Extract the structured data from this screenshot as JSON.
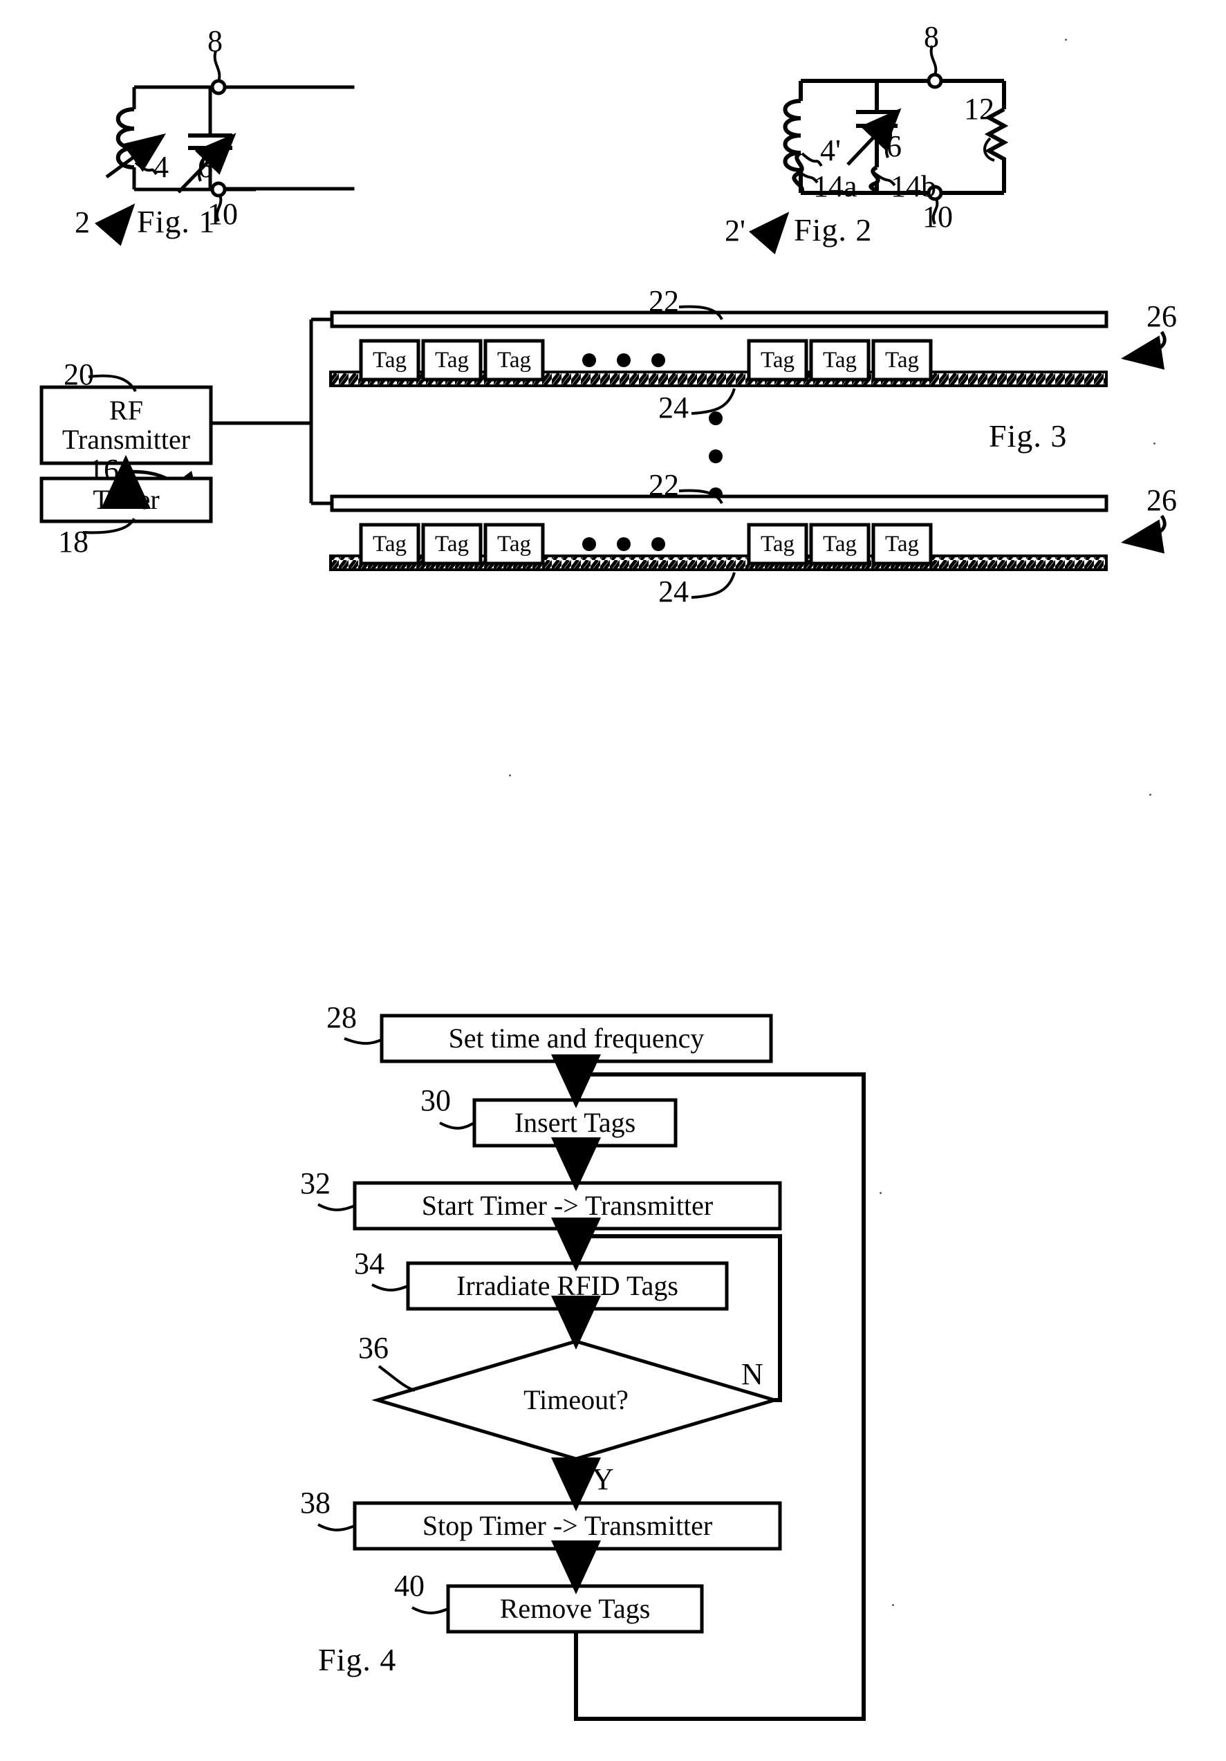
{
  "document": {
    "kind": "patent-drawing-sheet",
    "figures": [
      "Fig. 1",
      "Fig. 2",
      "Fig. 3",
      "Fig. 4"
    ]
  },
  "fig1": {
    "caption": "Fig. 1",
    "assembly_ref": "2",
    "refs": {
      "terminal_top": "8",
      "terminal_bottom": "10",
      "inductor": "4",
      "capacitor": "6"
    }
  },
  "fig2": {
    "caption": "Fig. 2",
    "assembly_ref": "2'",
    "refs": {
      "terminal_top": "8",
      "terminal_bottom": "10",
      "inductor": "4'",
      "capacitor": "6",
      "resistor": "12",
      "fuse_left": "14a",
      "fuse_right": "14b"
    }
  },
  "fig3": {
    "caption": "Fig. 3",
    "system_ref": "16",
    "blocks": [
      {
        "ref": "20",
        "label_line1": "RF",
        "label_line2": "Transmitter"
      },
      {
        "ref": "18",
        "label_line1": "Timer",
        "label_line2": ""
      }
    ],
    "refs": {
      "conveyor": "22",
      "substrate": "24",
      "tag_row": "26"
    },
    "tag_label": "Tag",
    "rows": [
      {
        "conveyor_ref": "22",
        "row_ref": "26",
        "substrate_ref": "24",
        "tags_left": [
          "Tag",
          "Tag",
          "Tag"
        ],
        "ellipsis": "• • •",
        "tags_right": [
          "Tag",
          "Tag",
          "Tag"
        ]
      },
      {
        "conveyor_ref": "22",
        "row_ref": "26",
        "substrate_ref": "24",
        "tags_left": [
          "Tag",
          "Tag",
          "Tag"
        ],
        "ellipsis": "• • •",
        "tags_right": [
          "Tag",
          "Tag",
          "Tag"
        ]
      }
    ],
    "vertical_ellipsis": "⋮"
  },
  "fig4": {
    "caption": "Fig. 4",
    "steps": [
      {
        "ref": "28",
        "label": "Set time and frequency",
        "shape": "rect"
      },
      {
        "ref": "30",
        "label": "Insert Tags",
        "shape": "rect"
      },
      {
        "ref": "32",
        "label": "Start Timer -> Transmitter",
        "shape": "rect"
      },
      {
        "ref": "34",
        "label": "Irradiate RFID Tags",
        "shape": "rect"
      },
      {
        "ref": "36",
        "label": "Timeout?",
        "shape": "diamond"
      },
      {
        "ref": "38",
        "label": "Stop Timer -> Transmitter",
        "shape": "rect"
      },
      {
        "ref": "40",
        "label": "Remove Tags",
        "shape": "rect"
      }
    ],
    "branch_labels": {
      "no": "N",
      "yes": "Y"
    }
  },
  "colors": {
    "ink": "#000000",
    "paper": "#ffffff"
  }
}
